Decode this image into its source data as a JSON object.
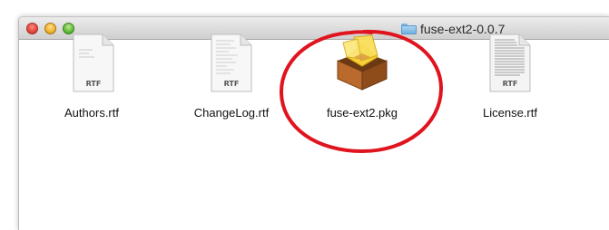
{
  "window": {
    "title": "fuse-ext2-0.0.7"
  },
  "files": [
    {
      "name": "Authors.rtf",
      "badge": "RTF",
      "icon": "rtf-document-icon"
    },
    {
      "name": "ChangeLog.rtf",
      "badge": "RTF",
      "icon": "rtf-document-icon"
    },
    {
      "name": "fuse-ext2.pkg",
      "icon": "package-installer-icon"
    },
    {
      "name": "License.rtf",
      "badge": "RTF",
      "icon": "rtf-document-icon"
    }
  ],
  "colors": {
    "highlight": "#e0141e",
    "title_bar": "#dcdcdc"
  }
}
